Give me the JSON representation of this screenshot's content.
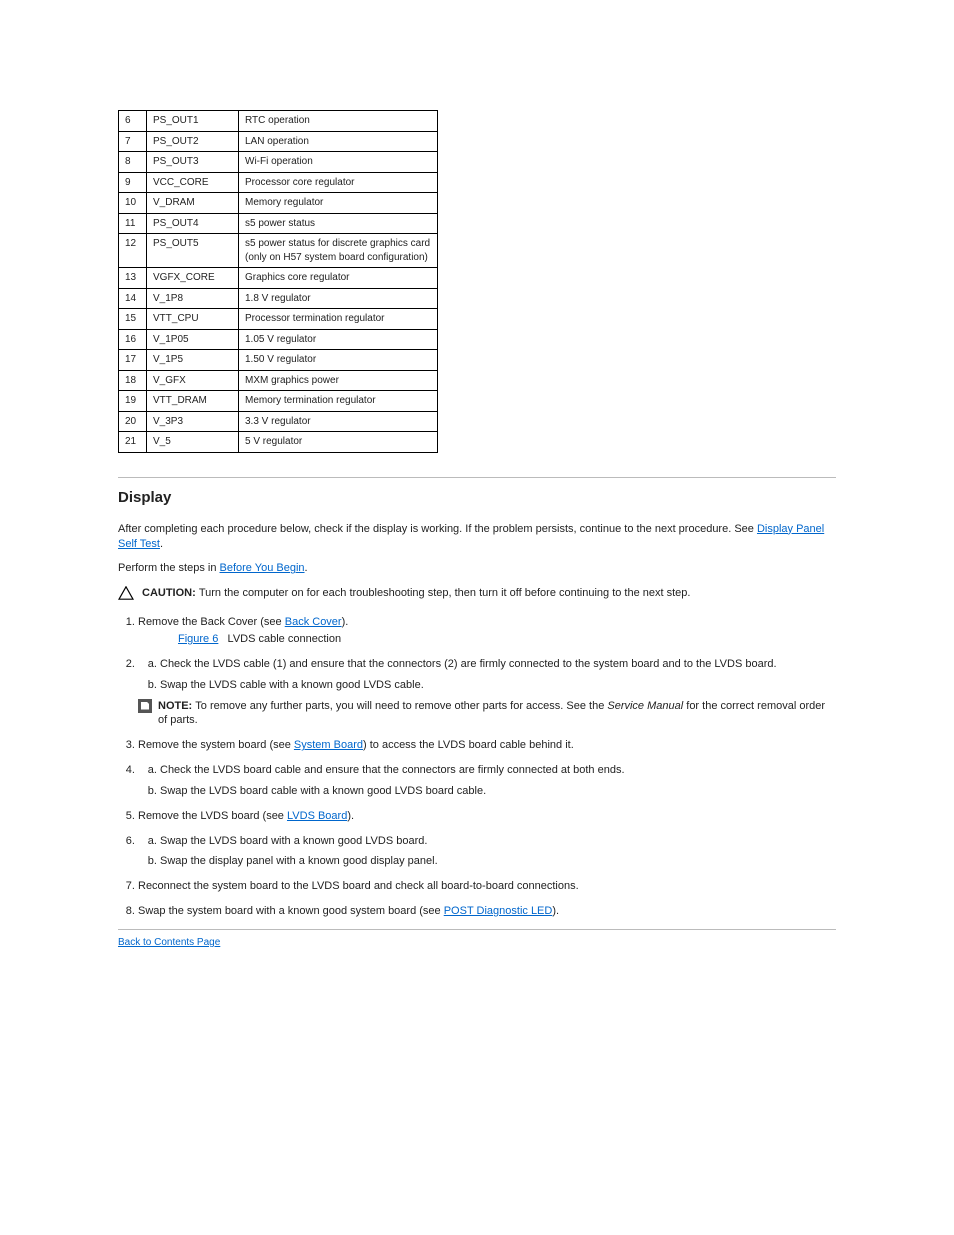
{
  "table": {
    "rows": [
      {
        "c1": "6",
        "c2": "PS_OUT1",
        "c3": "RTC operation"
      },
      {
        "c1": "7",
        "c2": "PS_OUT2",
        "c3": "LAN operation"
      },
      {
        "c1": "8",
        "c2": "PS_OUT3",
        "c3": "Wi-Fi operation"
      },
      {
        "c1": "9",
        "c2": "VCC_CORE",
        "c3": "Processor core regulator"
      },
      {
        "c1": "10",
        "c2": "V_DRAM",
        "c3": "Memory regulator"
      },
      {
        "c1": "11",
        "c2": "PS_OUT4",
        "c3": "s5 power status"
      },
      {
        "c1": "12",
        "c2": "PS_OUT5",
        "c3": "s5 power status for discrete graphics card (only on H57 system board configuration)"
      },
      {
        "c1": "13",
        "c2": "VGFX_CORE",
        "c3": "Graphics core regulator"
      },
      {
        "c1": "14",
        "c2": "V_1P8",
        "c3": "1.8 V regulator"
      },
      {
        "c1": "15",
        "c2": "VTT_CPU",
        "c3": "Processor termination regulator"
      },
      {
        "c1": "16",
        "c2": "V_1P05",
        "c3": "1.05 V regulator"
      },
      {
        "c1": "17",
        "c2": "V_1P5",
        "c3": "1.50 V regulator"
      },
      {
        "c1": "18",
        "c2": "V_GFX",
        "c3": "MXM graphics power"
      },
      {
        "c1": "19",
        "c2": "VTT_DRAM",
        "c3": "Memory termination regulator"
      },
      {
        "c1": "20",
        "c2": "V_3P3",
        "c3": "3.3 V regulator"
      },
      {
        "c1": "21",
        "c2": "V_5",
        "c3": "5 V regulator"
      }
    ]
  },
  "heading": "Display",
  "intro": {
    "t1": "After completing each procedure below, check if the display is working. If the problem persists, continue to the next procedure. See ",
    "link1": "Display Panel Self Test",
    "t2": ".",
    "t3": "Perform the steps in ",
    "link2": "Before You Begin",
    "t4": "."
  },
  "caution": {
    "label": "CAUTION: ",
    "text": "Turn the computer on for each troubleshooting step, then turn it off before continuing to the next step."
  },
  "steps": {
    "s1t1": "Remove the Back Cover (see ",
    "s1link": "Back Cover",
    "s1t2": ").",
    "figLabel": "",
    "figLinkLabel": "Figure 6",
    "figTitle": "LVDS cable connection",
    "s2a": "Check the LVDS cable (1) and ensure that the connectors (2) are firmly connected to the system board and to the LVDS board.",
    "s2b": "Swap the LVDS cable with a known good LVDS cable.",
    "note": {
      "label": "NOTE: ",
      "t1": "To remove any further parts, you will need to remove other parts for access. See the ",
      "em": "Service Manual",
      "t2": " for the correct removal order of parts."
    },
    "s3t1": "Remove the system board (see ",
    "s3link": "System Board",
    "s3t2": ") to access the LVDS board cable behind it.",
    "s4a": "Check the LVDS board cable and ensure that the connectors are firmly connected at both ends.",
    "s4b": "Swap the LVDS board cable with a known good LVDS board cable.",
    "s5t1": "Remove the LVDS board (see ",
    "s5link": "LVDS Board",
    "s5t2": ").",
    "s6a": "Swap the LVDS board with a known good LVDS board.",
    "s6b": "Swap the display panel with a known good display panel.",
    "s7": "Reconnect the system board to the LVDS board and check all board-to-board connections.",
    "s8t1": "Swap the system board with a known good system board (see ",
    "s8link": "POST Diagnostic LED",
    "s8t2": ")."
  },
  "backLink": "Back to Contents Page"
}
